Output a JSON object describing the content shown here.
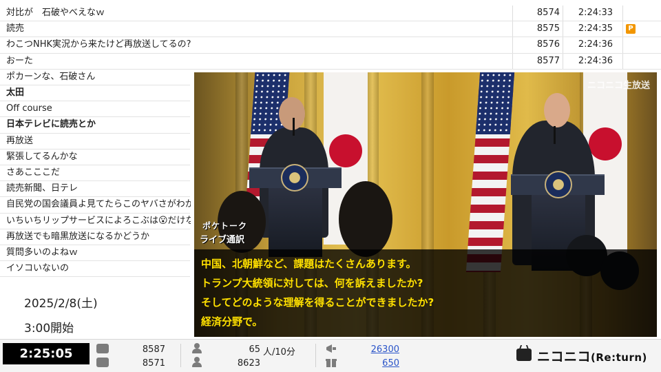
{
  "comments": [
    {
      "text": "対比が　石破やべえなｗ",
      "number": "8574",
      "time": "2:24:33",
      "premium": false,
      "bold": false,
      "full": true
    },
    {
      "text": "読売",
      "number": "8575",
      "time": "2:24:35",
      "premium": true,
      "premium_label": "P",
      "bold": false,
      "full": true
    },
    {
      "text": "わこつNHK実況から来たけど再放送してるの?",
      "number": "8576",
      "time": "2:24:36",
      "premium": false,
      "bold": false,
      "full": true
    },
    {
      "text": "おーた",
      "number": "8577",
      "time": "2:24:36",
      "premium": false,
      "bold": false,
      "full": true
    },
    {
      "text": "ポカーンな、石破さん",
      "bold": false,
      "full": false
    },
    {
      "text": "太田",
      "bold": true,
      "full": false
    },
    {
      "text": "Off course",
      "bold": false,
      "full": false
    },
    {
      "text": "日本テレビに読売とか",
      "bold": true,
      "full": false
    },
    {
      "text": "再放送",
      "bold": false,
      "full": false
    },
    {
      "text": "緊張してるんかな",
      "bold": false,
      "full": false
    },
    {
      "text": "さあこここだ",
      "bold": false,
      "full": false
    },
    {
      "text": "読売新聞、日テレ",
      "bold": false,
      "full": false
    },
    {
      "text": "自民党の国会議員よ見てたらこのヤバさがわかるか",
      "bold": false,
      "full": false
    },
    {
      "text": "いちいちリップサービスによろこぶは😮だけな",
      "bold": false,
      "full": false
    },
    {
      "text": "再放送でも暗黒放送になるかどうか",
      "bold": false,
      "full": false
    },
    {
      "text": "質問多いのよねｗ",
      "bold": false,
      "full": false
    },
    {
      "text": "イソコいないの",
      "bold": false,
      "full": false
    }
  ],
  "info": {
    "date": "2025/2/8(土)",
    "start": "3:00開始"
  },
  "video": {
    "watermark": "ニコニコ生放送",
    "badge_line1": "ポケトーク",
    "badge_line2": "ライブ通訳",
    "subtitles": [
      "中国、北朝鮮など、課題はたくさんあります。",
      "トランプ大統領に対しては、何を訴えましたか?",
      "そしてどのような理解を得ることができましたか?",
      "経済分野で。"
    ]
  },
  "bottom": {
    "timer": "2:25:05",
    "comments_total": "8587",
    "comments_sub": "8571",
    "viewers_rate": "65",
    "viewers_rate_unit": "人/10分",
    "viewers_total": "8623",
    "ad_points": "26300",
    "gift_points": "650",
    "brand_main": "ニコニコ",
    "brand_sub": "(Re:turn)"
  },
  "colors": {
    "premium": "#f29600",
    "link": "#2a54c9",
    "subtitle": "#ffe000",
    "timer_bg": "#000000"
  },
  "icons": [
    "comment-bubble-icon",
    "viewer-person-icon",
    "ad-megaphone-icon",
    "gift-box-icon",
    "tv-logo-icon"
  ]
}
